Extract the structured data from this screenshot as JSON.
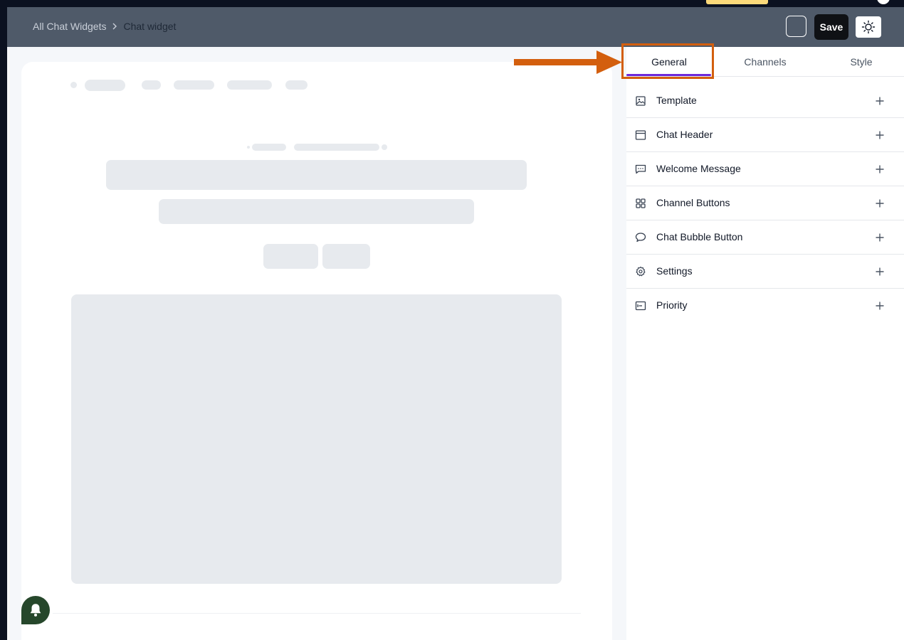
{
  "header": {
    "breadcrumb_root": "All Chat Widgets",
    "breadcrumb_current": "Chat widget",
    "save_label": "Save"
  },
  "tabs": [
    {
      "label": "General",
      "active": true
    },
    {
      "label": "Channels",
      "active": false
    },
    {
      "label": "Style",
      "active": false
    }
  ],
  "sections": [
    {
      "label": "Template",
      "icon": "image-icon"
    },
    {
      "label": "Chat Header",
      "icon": "window-icon"
    },
    {
      "label": "Welcome Message",
      "icon": "message-icon"
    },
    {
      "label": "Channel Buttons",
      "icon": "grid-icon"
    },
    {
      "label": "Chat Bubble Button",
      "icon": "chat-bubble-icon"
    },
    {
      "label": "Settings",
      "icon": "gear-icon"
    },
    {
      "label": "Priority",
      "icon": "priority-icon"
    }
  ],
  "colors": {
    "header_bg": "#4f5a69",
    "active_tab_underline": "#6d28d9",
    "annotation": "#d35f0e",
    "bell_bg": "#26472b"
  }
}
